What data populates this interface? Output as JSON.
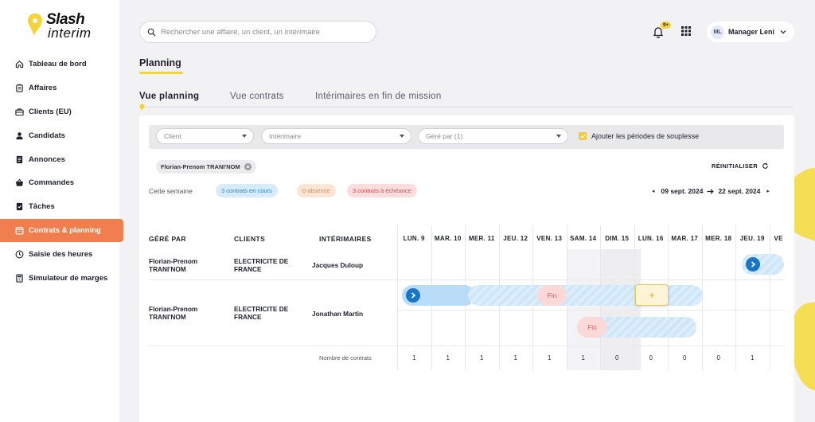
{
  "brand": {
    "line1": "Slash",
    "line2": "interim"
  },
  "sidebar": {
    "items": [
      {
        "label": "Tableau de bord",
        "icon": "home-icon"
      },
      {
        "label": "Affaires",
        "icon": "clipboard-icon"
      },
      {
        "label": "Clients (EU)",
        "icon": "briefcase-icon"
      },
      {
        "label": "Candidats",
        "icon": "person-icon"
      },
      {
        "label": "Annonces",
        "icon": "document-icon"
      },
      {
        "label": "Commandes",
        "icon": "basket-icon"
      },
      {
        "label": "Tâches",
        "icon": "task-icon"
      },
      {
        "label": "Contrats & planning",
        "icon": "calendar-icon",
        "active": true
      },
      {
        "label": "Saisie des heures",
        "icon": "clock-icon"
      },
      {
        "label": "Simulateur de marges",
        "icon": "calculator-icon"
      }
    ]
  },
  "header": {
    "search_placeholder": "Rechercher une affaire, un client, un intérimaire",
    "notif_badge": "9+",
    "user_initials": "ML",
    "user_name": "Manager Leni"
  },
  "page": {
    "title": "Planning"
  },
  "tabs": [
    {
      "label": "Vue planning",
      "active": true
    },
    {
      "label": "Vue contrats"
    },
    {
      "label": "Intérimaires en fin de mission"
    }
  ],
  "filters": {
    "client_placeholder": "Client",
    "interimaire_placeholder": "Intérimaire",
    "gere_par_placeholder": "Géré par (1)",
    "souplesse_label": "Ajouter les périodes de souplesse",
    "chip_label": "Florian-Prenom TRANI'NOM",
    "reset_label": "RÉINITIALISER"
  },
  "summary": {
    "week_label": "Cette semaine",
    "in_progress": "3 contrats en cours",
    "absence": "0 absence",
    "due": "3 contrats à échéance",
    "date_start": "09 sept. 2024",
    "date_end": "22 sept. 2024"
  },
  "table": {
    "headers": {
      "manager": "GÉRÉ PAR",
      "clients": "CLIENTS",
      "interims": "INTÉRIMAIRES"
    },
    "days": [
      "LUN. 9",
      "MAR. 10",
      "MER. 11",
      "JEU. 12",
      "VEN. 13",
      "SAM. 14",
      "DIM. 15",
      "LUN. 16",
      "MAR. 17",
      "MER. 18",
      "JEU. 19",
      "VE"
    ],
    "rows": [
      {
        "manager_l1": "Florian-Prenom",
        "manager_l2": "TRANI'NOM",
        "client_l1": "ELECTRICITE DE",
        "client_l2": "FRANCE",
        "interim": "Jacques Duloup"
      },
      {
        "manager_l1": "Florian-Prenom",
        "manager_l2": "TRANI'NOM",
        "client_l1": "ELECTRICITE DE",
        "client_l2": "FRANCE",
        "interim": "Jonathan Martin"
      }
    ],
    "fin_label": "Fin",
    "plus_label": "+",
    "count_label": "Nombre de contrats",
    "counts": [
      "1",
      "1",
      "1",
      "1",
      "1",
      "1",
      "0",
      "0",
      "0",
      "0",
      "1"
    ]
  },
  "colors": {
    "accent_orange": "#f07e4e",
    "accent_yellow": "#f5d43a",
    "contract_blue": "#1976c7",
    "fin_red": "#d85757"
  }
}
